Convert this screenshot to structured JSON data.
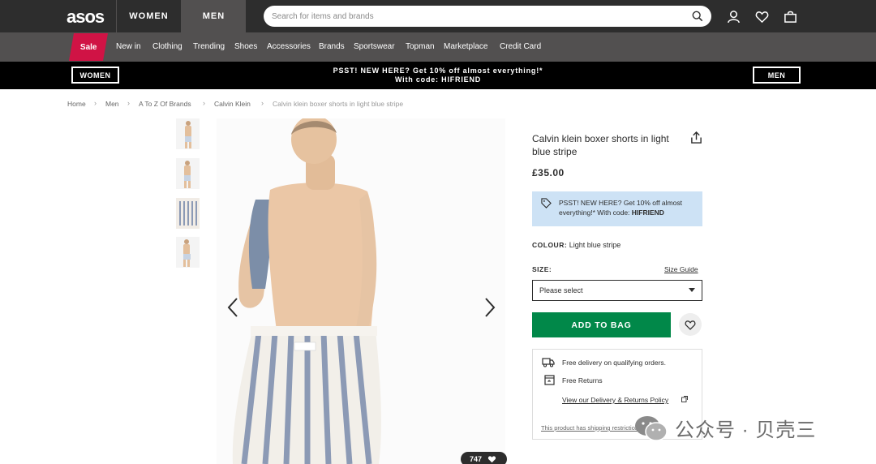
{
  "header": {
    "logo": "asos",
    "tabs": [
      {
        "label": "WOMEN"
      },
      {
        "label": "MEN"
      }
    ],
    "search_placeholder": "Search for items and brands"
  },
  "nav": {
    "sale": "Sale",
    "items": [
      "New in",
      "Clothing",
      "Trending",
      "Shoes",
      "Accessories",
      "Brands",
      "Sportswear",
      "Topman",
      "Marketplace",
      "Credit Card"
    ]
  },
  "promo_bar": {
    "left_button": "WOMEN",
    "right_button": "MEN",
    "line1": "PSST! NEW HERE? Get 10% off almost everything!*",
    "line2": "With code: HIFRIEND"
  },
  "breadcrumb": [
    "Home",
    "Men",
    "A To Z Of Brands",
    "Calvin Klein",
    "Calvin klein boxer shorts in light blue stripe"
  ],
  "product": {
    "name": "Calvin klein boxer shorts in light blue stripe",
    "price": "£35.00",
    "promo_text": "PSST! NEW HERE? Get 10% off almost everything!* With code:",
    "promo_code": "HIFRIEND",
    "colour_label": "COLOUR:",
    "colour_value": "Light blue stripe",
    "size_label": "SIZE:",
    "size_guide": "Size Guide",
    "size_placeholder": "Please select",
    "add_to_bag": "ADD TO BAG",
    "saves_count": "747",
    "delivery": {
      "free_delivery": "Free delivery on qualifying orders.",
      "free_returns": "Free Returns",
      "policy_link": "View our Delivery & Returns Policy",
      "restrictions": "This product has shipping restrictions"
    }
  },
  "watermark": "公众号 · 贝壳三",
  "colors": {
    "header_bg": "#2d2d2d",
    "nav_bg": "#525050",
    "sale_bg": "#d01345",
    "add_btn": "#018849",
    "promo_box": "#cde2f5"
  }
}
